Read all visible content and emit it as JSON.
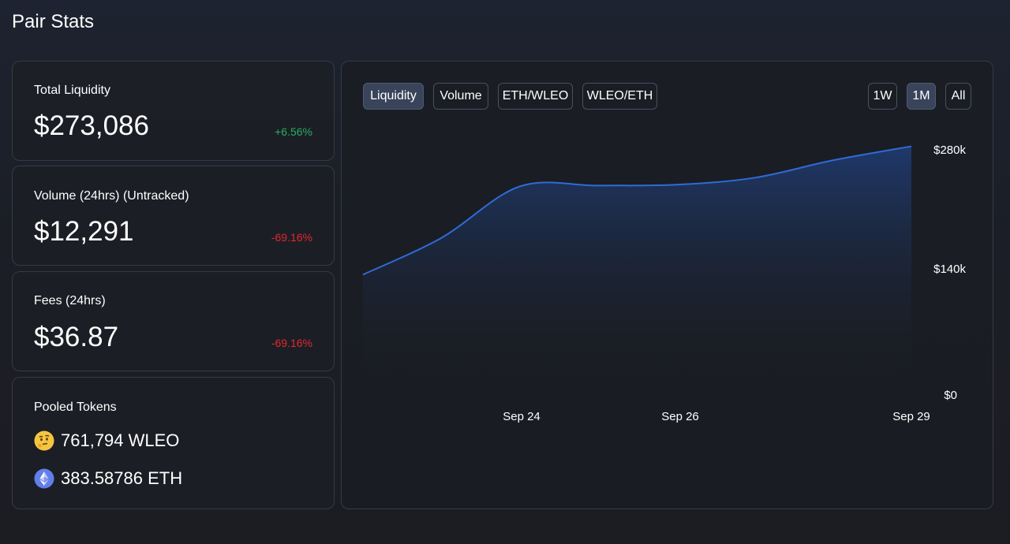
{
  "page": {
    "title": "Pair Stats"
  },
  "stats": {
    "liquidity": {
      "label": "Total Liquidity",
      "value": "$273,086",
      "change": "+6.56%"
    },
    "volume": {
      "label": "Volume (24hrs) (Untracked)",
      "value": "$12,291",
      "change": "-69.16%"
    },
    "fees": {
      "label": "Fees (24hrs)",
      "value": "$36.87",
      "change": "-69.16%"
    }
  },
  "pooled": {
    "label": "Pooled Tokens",
    "tokens": [
      {
        "text": "761,794 WLEO",
        "icon": "thinking-face-icon"
      },
      {
        "text": "383.58786 ETH",
        "icon": "ethereum-icon"
      }
    ]
  },
  "chart_tabs": [
    "Liquidity",
    "Volume",
    "ETH/WLEO",
    "WLEO/ETH"
  ],
  "active_tab": "Liquidity",
  "range_tabs": [
    "1W",
    "1M",
    "All"
  ],
  "active_range": "1M",
  "colors": {
    "line": "#2f6bd6",
    "area_top": "#1f3a6e",
    "positive": "#27ae60",
    "negative": "#e3282b"
  },
  "chart_data": {
    "type": "area",
    "title": "",
    "xlabel": "",
    "ylabel": "",
    "x_ticks": [
      "Sep 24",
      "Sep 26",
      "Sep 29"
    ],
    "y_ticks": [
      "$0",
      "$140k",
      "$280k"
    ],
    "ylim": [
      0,
      280000
    ],
    "x": [
      "Sep 22",
      "Sep 23",
      "Sep 24",
      "Sep 25",
      "Sep 26",
      "Sep 27",
      "Sep 28",
      "Sep 29"
    ],
    "values": [
      137000,
      179000,
      238000,
      239000,
      240000,
      248000,
      268000,
      284000
    ]
  }
}
